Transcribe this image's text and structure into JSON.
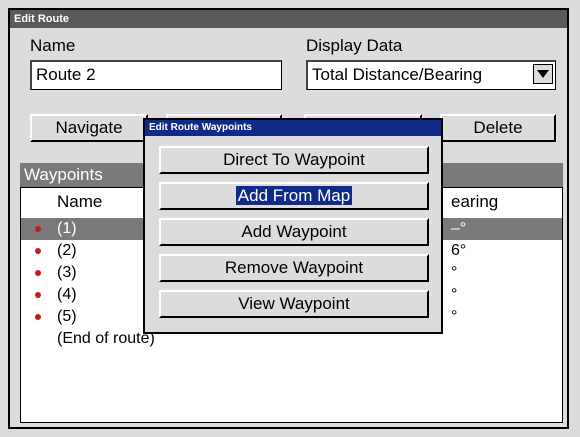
{
  "window": {
    "title": "Edit Route"
  },
  "name_field": {
    "label": "Name",
    "value": "Route 2"
  },
  "display_data": {
    "label": "Display Data",
    "value": "Total Distance/Bearing"
  },
  "buttons": {
    "navigate": "Navigate",
    "delete": "Delete"
  },
  "waypoints": {
    "header": "Waypoints",
    "col_name": "Name",
    "col_bearing": "earing",
    "rows": [
      {
        "name": "(1)",
        "bearing": "–°"
      },
      {
        "name": "(2)",
        "bearing": "6°"
      },
      {
        "name": "(3)",
        "bearing": "°"
      },
      {
        "name": "(4)",
        "bearing": "°"
      },
      {
        "name": "(5)",
        "bearing": "°"
      }
    ],
    "end_label": "(End of route)"
  },
  "popup": {
    "title": "Edit Route Waypoints",
    "items": [
      "Direct To Waypoint",
      "Add From Map",
      "Add Waypoint",
      "Remove Waypoint",
      "View Waypoint"
    ],
    "highlighted_item": "Add From Map"
  }
}
